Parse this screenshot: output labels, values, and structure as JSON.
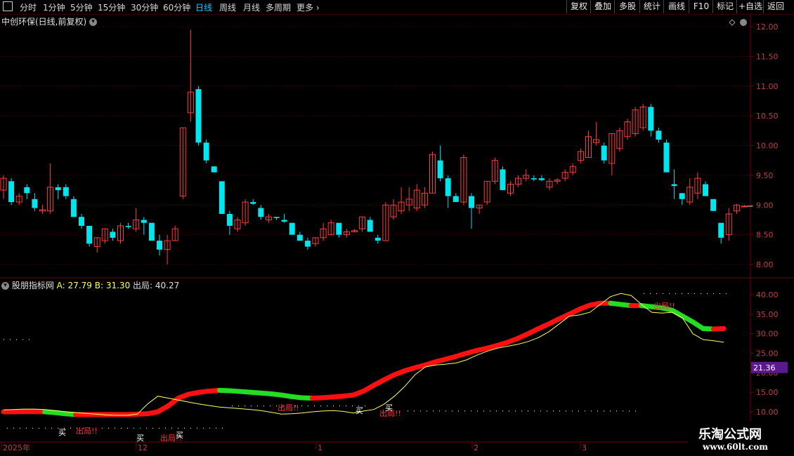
{
  "toolbar": {
    "menu_icon": "menu-icon",
    "periods": [
      "分时",
      "1分钟",
      "5分钟",
      "15分钟",
      "30分钟",
      "60分钟",
      "日线",
      "周线",
      "月线",
      "多周期",
      "更多"
    ],
    "active_period": "日线",
    "right_buttons": [
      "复权",
      "叠加",
      "多股",
      "统计",
      "画线",
      "F10",
      "标记",
      "+自选",
      "返回"
    ]
  },
  "kline": {
    "title": "中创环保(日线,前复权)",
    "y_ticks": [
      "12.00",
      "11.50",
      "11.00",
      "10.50",
      "10.00",
      "9.50",
      "9.00",
      "8.50",
      "8.00"
    ]
  },
  "indicator": {
    "name": "股朋指标网",
    "a_label": "A:",
    "a_value": "27.79",
    "b_label": "B:",
    "b_value": "31.30",
    "c_label": "出局:",
    "c_value": "40.27",
    "y_ticks": [
      "40.00",
      "35.00",
      "30.00",
      "25.00",
      "20.00",
      "15.00",
      "10.00"
    ],
    "current_value": "21.36",
    "signals": {
      "buy": "买",
      "sell": "出局!!"
    }
  },
  "xaxis": {
    "labels": [
      "2025年",
      "12",
      "1",
      "2",
      "3"
    ]
  },
  "watermark": {
    "line1": "乐淘公式网",
    "line2": "www.60lt.com"
  },
  "colors": {
    "up": "#ff3c3c",
    "down": "#00e5ee",
    "axis": "#7a0000",
    "grid": "#7a0000",
    "line_a": "#ffff66",
    "band_up": "#ff1010",
    "band_down": "#22dd22",
    "highlight": "#5a1a8c"
  },
  "chart_data": {
    "type": "candlestick",
    "ylim": [
      7.8,
      12.2
    ],
    "candles": [
      {
        "o": 9.25,
        "h": 9.5,
        "l": 9.1,
        "c": 9.45
      },
      {
        "o": 9.4,
        "h": 9.45,
        "l": 9.0,
        "c": 9.05
      },
      {
        "o": 9.05,
        "h": 9.2,
        "l": 9.0,
        "c": 9.15
      },
      {
        "o": 9.3,
        "h": 9.35,
        "l": 9.1,
        "c": 9.2
      },
      {
        "o": 9.1,
        "h": 9.2,
        "l": 8.9,
        "c": 8.95
      },
      {
        "o": 8.9,
        "h": 9.0,
        "l": 8.85,
        "c": 8.92
      },
      {
        "o": 8.9,
        "h": 9.7,
        "l": 8.85,
        "c": 9.3
      },
      {
        "o": 9.3,
        "h": 9.35,
        "l": 9.1,
        "c": 9.25
      },
      {
        "o": 9.3,
        "h": 9.35,
        "l": 9.1,
        "c": 9.15
      },
      {
        "o": 9.1,
        "h": 9.15,
        "l": 8.8,
        "c": 8.8
      },
      {
        "o": 8.8,
        "h": 8.85,
        "l": 8.6,
        "c": 8.65
      },
      {
        "o": 8.65,
        "h": 8.65,
        "l": 8.3,
        "c": 8.35
      },
      {
        "o": 8.3,
        "h": 8.45,
        "l": 8.2,
        "c": 8.45
      },
      {
        "o": 8.4,
        "h": 8.6,
        "l": 8.35,
        "c": 8.6
      },
      {
        "o": 8.55,
        "h": 8.6,
        "l": 8.4,
        "c": 8.45
      },
      {
        "o": 8.4,
        "h": 8.7,
        "l": 8.35,
        "c": 8.65
      },
      {
        "o": 8.65,
        "h": 8.7,
        "l": 8.6,
        "c": 8.63
      },
      {
        "o": 8.6,
        "h": 8.95,
        "l": 8.55,
        "c": 8.75
      },
      {
        "o": 8.75,
        "h": 8.8,
        "l": 8.5,
        "c": 8.7
      },
      {
        "o": 8.7,
        "h": 8.7,
        "l": 8.4,
        "c": 8.4
      },
      {
        "o": 8.4,
        "h": 8.5,
        "l": 8.15,
        "c": 8.25
      },
      {
        "o": 8.25,
        "h": 8.5,
        "l": 8.0,
        "c": 8.4
      },
      {
        "o": 8.4,
        "h": 8.65,
        "l": 8.4,
        "c": 8.6
      },
      {
        "o": 9.15,
        "h": 10.3,
        "l": 9.1,
        "c": 10.3
      },
      {
        "o": 10.55,
        "h": 11.95,
        "l": 10.4,
        "c": 10.9
      },
      {
        "o": 10.95,
        "h": 11.0,
        "l": 10.0,
        "c": 10.05
      },
      {
        "o": 10.05,
        "h": 10.1,
        "l": 9.7,
        "c": 9.75
      },
      {
        "o": 9.65,
        "h": 9.65,
        "l": 9.55,
        "c": 9.55
      },
      {
        "o": 9.4,
        "h": 9.4,
        "l": 8.85,
        "c": 8.85
      },
      {
        "o": 8.85,
        "h": 8.9,
        "l": 8.5,
        "c": 8.65
      },
      {
        "o": 8.6,
        "h": 8.8,
        "l": 8.55,
        "c": 8.75
      },
      {
        "o": 8.7,
        "h": 9.1,
        "l": 8.65,
        "c": 9.05
      },
      {
        "o": 9.05,
        "h": 9.1,
        "l": 9.0,
        "c": 9.02
      },
      {
        "o": 8.95,
        "h": 9.0,
        "l": 8.75,
        "c": 8.8
      },
      {
        "o": 8.75,
        "h": 8.85,
        "l": 8.7,
        "c": 8.8
      },
      {
        "o": 8.8,
        "h": 8.8,
        "l": 8.75,
        "c": 8.78
      },
      {
        "o": 8.75,
        "h": 8.85,
        "l": 8.7,
        "c": 8.72
      },
      {
        "o": 8.7,
        "h": 8.7,
        "l": 8.5,
        "c": 8.5
      },
      {
        "o": 8.5,
        "h": 8.55,
        "l": 8.4,
        "c": 8.4
      },
      {
        "o": 8.4,
        "h": 8.45,
        "l": 8.25,
        "c": 8.3
      },
      {
        "o": 8.35,
        "h": 8.45,
        "l": 8.3,
        "c": 8.45
      },
      {
        "o": 8.45,
        "h": 8.7,
        "l": 8.4,
        "c": 8.6
      },
      {
        "o": 8.5,
        "h": 8.75,
        "l": 8.5,
        "c": 8.7
      },
      {
        "o": 8.7,
        "h": 8.7,
        "l": 8.45,
        "c": 8.5
      },
      {
        "o": 8.5,
        "h": 8.6,
        "l": 8.45,
        "c": 8.55
      },
      {
        "o": 8.55,
        "h": 8.6,
        "l": 8.55,
        "c": 8.57
      },
      {
        "o": 8.6,
        "h": 8.8,
        "l": 8.55,
        "c": 8.8
      },
      {
        "o": 8.75,
        "h": 8.8,
        "l": 8.55,
        "c": 8.55
      },
      {
        "o": 8.45,
        "h": 8.5,
        "l": 8.35,
        "c": 8.4
      },
      {
        "o": 8.4,
        "h": 9.05,
        "l": 8.4,
        "c": 9.0
      },
      {
        "o": 8.8,
        "h": 9.1,
        "l": 8.75,
        "c": 9.0
      },
      {
        "o": 8.9,
        "h": 9.3,
        "l": 8.85,
        "c": 9.05
      },
      {
        "o": 9.0,
        "h": 9.3,
        "l": 8.9,
        "c": 9.1
      },
      {
        "o": 8.95,
        "h": 9.35,
        "l": 8.9,
        "c": 9.25
      },
      {
        "o": 9.0,
        "h": 9.3,
        "l": 8.95,
        "c": 9.2
      },
      {
        "o": 9.2,
        "h": 9.9,
        "l": 9.2,
        "c": 9.85
      },
      {
        "o": 9.75,
        "h": 10.0,
        "l": 9.4,
        "c": 9.45
      },
      {
        "o": 9.45,
        "h": 9.5,
        "l": 8.95,
        "c": 9.15
      },
      {
        "o": 9.15,
        "h": 9.2,
        "l": 9.05,
        "c": 9.05
      },
      {
        "o": 9.05,
        "h": 9.85,
        "l": 9.0,
        "c": 9.8
      },
      {
        "o": 9.15,
        "h": 9.2,
        "l": 8.6,
        "c": 8.95
      },
      {
        "o": 8.95,
        "h": 9.0,
        "l": 8.85,
        "c": 9.0
      },
      {
        "o": 9.05,
        "h": 9.4,
        "l": 9.0,
        "c": 9.4
      },
      {
        "o": 9.4,
        "h": 9.8,
        "l": 9.35,
        "c": 9.75
      },
      {
        "o": 9.6,
        "h": 9.65,
        "l": 9.25,
        "c": 9.25
      },
      {
        "o": 9.2,
        "h": 9.4,
        "l": 9.15,
        "c": 9.35
      },
      {
        "o": 9.35,
        "h": 9.5,
        "l": 9.3,
        "c": 9.45
      },
      {
        "o": 9.45,
        "h": 9.6,
        "l": 9.4,
        "c": 9.5
      },
      {
        "o": 9.45,
        "h": 9.5,
        "l": 9.4,
        "c": 9.43
      },
      {
        "o": 9.45,
        "h": 9.5,
        "l": 9.4,
        "c": 9.42
      },
      {
        "o": 9.3,
        "h": 9.45,
        "l": 9.25,
        "c": 9.4
      },
      {
        "o": 9.4,
        "h": 9.45,
        "l": 9.35,
        "c": 9.42
      },
      {
        "o": 9.45,
        "h": 9.6,
        "l": 9.4,
        "c": 9.55
      },
      {
        "o": 9.55,
        "h": 9.7,
        "l": 9.5,
        "c": 9.65
      },
      {
        "o": 9.75,
        "h": 9.95,
        "l": 9.7,
        "c": 9.9
      },
      {
        "o": 9.8,
        "h": 10.25,
        "l": 9.8,
        "c": 10.15
      },
      {
        "o": 10.05,
        "h": 10.4,
        "l": 10.0,
        "c": 10.1
      },
      {
        "o": 10.0,
        "h": 10.05,
        "l": 9.7,
        "c": 9.75
      },
      {
        "o": 9.7,
        "h": 10.2,
        "l": 9.5,
        "c": 10.2
      },
      {
        "o": 9.95,
        "h": 10.3,
        "l": 9.9,
        "c": 10.25
      },
      {
        "o": 10.15,
        "h": 10.45,
        "l": 10.1,
        "c": 10.4
      },
      {
        "o": 10.2,
        "h": 10.65,
        "l": 10.15,
        "c": 10.6
      },
      {
        "o": 10.3,
        "h": 10.7,
        "l": 10.25,
        "c": 10.65
      },
      {
        "o": 10.65,
        "h": 10.7,
        "l": 10.15,
        "c": 10.25
      },
      {
        "o": 10.25,
        "h": 10.3,
        "l": 10.05,
        "c": 10.1
      },
      {
        "o": 10.05,
        "h": 10.1,
        "l": 9.55,
        "c": 9.55
      },
      {
        "o": 9.35,
        "h": 9.6,
        "l": 9.1,
        "c": 9.32
      },
      {
        "o": 9.2,
        "h": 9.2,
        "l": 9.0,
        "c": 9.1
      },
      {
        "o": 9.05,
        "h": 9.45,
        "l": 9.0,
        "c": 9.3
      },
      {
        "o": 9.2,
        "h": 9.55,
        "l": 9.1,
        "c": 9.45
      },
      {
        "o": 9.35,
        "h": 9.4,
        "l": 9.15,
        "c": 9.15
      },
      {
        "o": 9.1,
        "h": 9.1,
        "l": 8.9,
        "c": 8.9
      },
      {
        "o": 8.7,
        "h": 8.7,
        "l": 8.35,
        "c": 8.45
      },
      {
        "o": 8.5,
        "h": 8.95,
        "l": 8.4,
        "c": 8.85
      },
      {
        "o": 8.9,
        "h": 9.02,
        "l": 8.85,
        "c": 9.0
      },
      {
        "o": 8.98,
        "h": 9.0,
        "l": 8.97,
        "c": 8.98
      }
    ],
    "indicator_range": [
      5,
      42
    ],
    "series": [
      {
        "name": "A",
        "values": [
          10.5,
          10.6,
          10.7,
          10.7,
          10.6,
          10.3,
          10.0,
          9.8,
          9.6,
          9.4,
          9.2,
          9.1,
          9.1,
          9.4,
          12.0,
          14.0,
          13.5,
          13.0,
          12.5,
          12.0,
          11.6,
          11.2,
          11.0,
          10.8,
          10.6,
          10.3,
          9.9,
          9.4,
          9.5,
          9.7,
          10.0,
          10.2,
          10.3,
          10.1,
          9.7,
          10.2,
          10.6,
          12.0,
          14.0,
          16.5,
          19.5,
          21.5,
          22.0,
          22.2,
          22.5,
          23.3,
          24.5,
          25.5,
          26.3,
          26.8,
          27.3,
          28.0,
          29.0,
          30.5,
          32.5,
          34.5,
          34.8,
          35.5,
          37.5,
          39.5,
          40.3,
          39.8,
          37.5,
          35.5,
          35.3,
          35.5,
          34.0,
          30.0,
          28.5,
          28.2,
          27.8
        ]
      },
      {
        "name": "B",
        "values": [
          10.0,
          10.0,
          10.05,
          10.05,
          10.0,
          9.8,
          9.5,
          9.3,
          9.3,
          9.3,
          9.3,
          9.3,
          9.3,
          9.4,
          9.5,
          10.0,
          11.5,
          13.5,
          14.5,
          15.0,
          15.3,
          15.5,
          15.4,
          15.2,
          15.0,
          14.8,
          14.6,
          14.3,
          13.9,
          13.6,
          13.5,
          13.6,
          13.8,
          14.0,
          14.3,
          15.3,
          16.8,
          18.2,
          19.5,
          20.5,
          21.3,
          22.0,
          22.8,
          23.5,
          24.2,
          25.0,
          25.7,
          26.3,
          27.0,
          27.8,
          28.8,
          30.0,
          31.3,
          32.5,
          33.8,
          35.0,
          36.3,
          37.3,
          37.8,
          37.8,
          37.5,
          37.2,
          37.2,
          36.9,
          36.6,
          36.0,
          34.5,
          33.0,
          31.3,
          31.2,
          31.3
        ]
      }
    ]
  }
}
